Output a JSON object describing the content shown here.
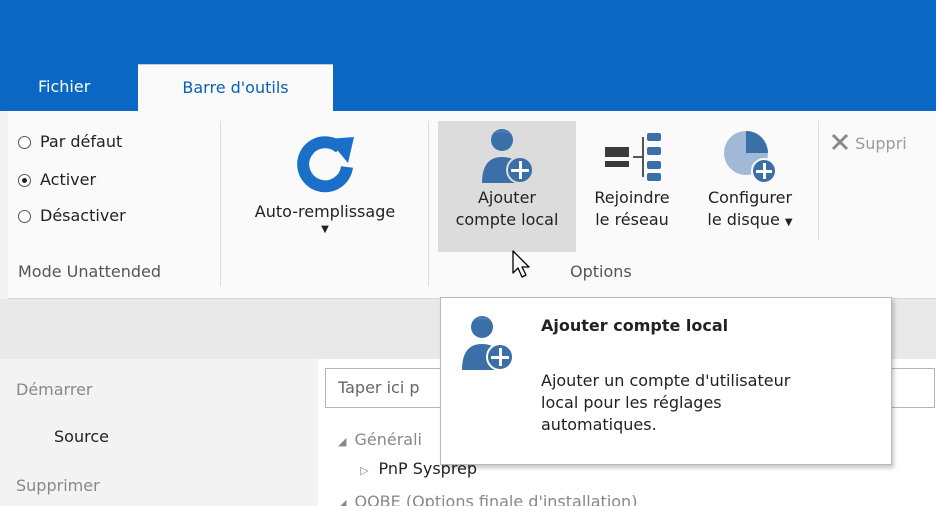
{
  "tabs": {
    "file": "Fichier",
    "toolbar": "Barre d'outils"
  },
  "mode_group": {
    "options": [
      {
        "label": "Par défaut",
        "selected": false
      },
      {
        "label": "Activer",
        "selected": true
      },
      {
        "label": "Désactiver",
        "selected": false
      }
    ],
    "label": "Mode Unattended"
  },
  "autofill": {
    "label": "Auto-remplissage",
    "icon": "refresh-icon"
  },
  "options_group": {
    "label": "Options",
    "add_account": {
      "line1": "Ajouter",
      "line2": "compte local",
      "icon": "add-user-icon"
    },
    "join_network": {
      "line1": "Rejoindre",
      "line2": "le réseau",
      "icon": "network-icon"
    },
    "configure_disk": {
      "line1": "Configurer",
      "line2": "le disque",
      "icon": "disk-add-icon"
    }
  },
  "delete_button": {
    "label": "Suppri",
    "icon": "close-icon"
  },
  "nav": {
    "start": "Démarrer",
    "source": "Source",
    "delete": "Supprimer"
  },
  "search": {
    "placeholder": "Taper ici p"
  },
  "tree": {
    "general": "Générali",
    "pnp": "PnP Sysprep",
    "oobe": "OOBE (Options finale d'installation)"
  },
  "tooltip": {
    "title": "Ajouter compte local",
    "description": "Ajouter un compte d'utilisateur\nlocal pour les réglages\nautomatiques."
  },
  "colors": {
    "titlebar": "#0a67c4",
    "tab_text": "#0a5fb6",
    "icon_blue": "#1a6fc8"
  }
}
